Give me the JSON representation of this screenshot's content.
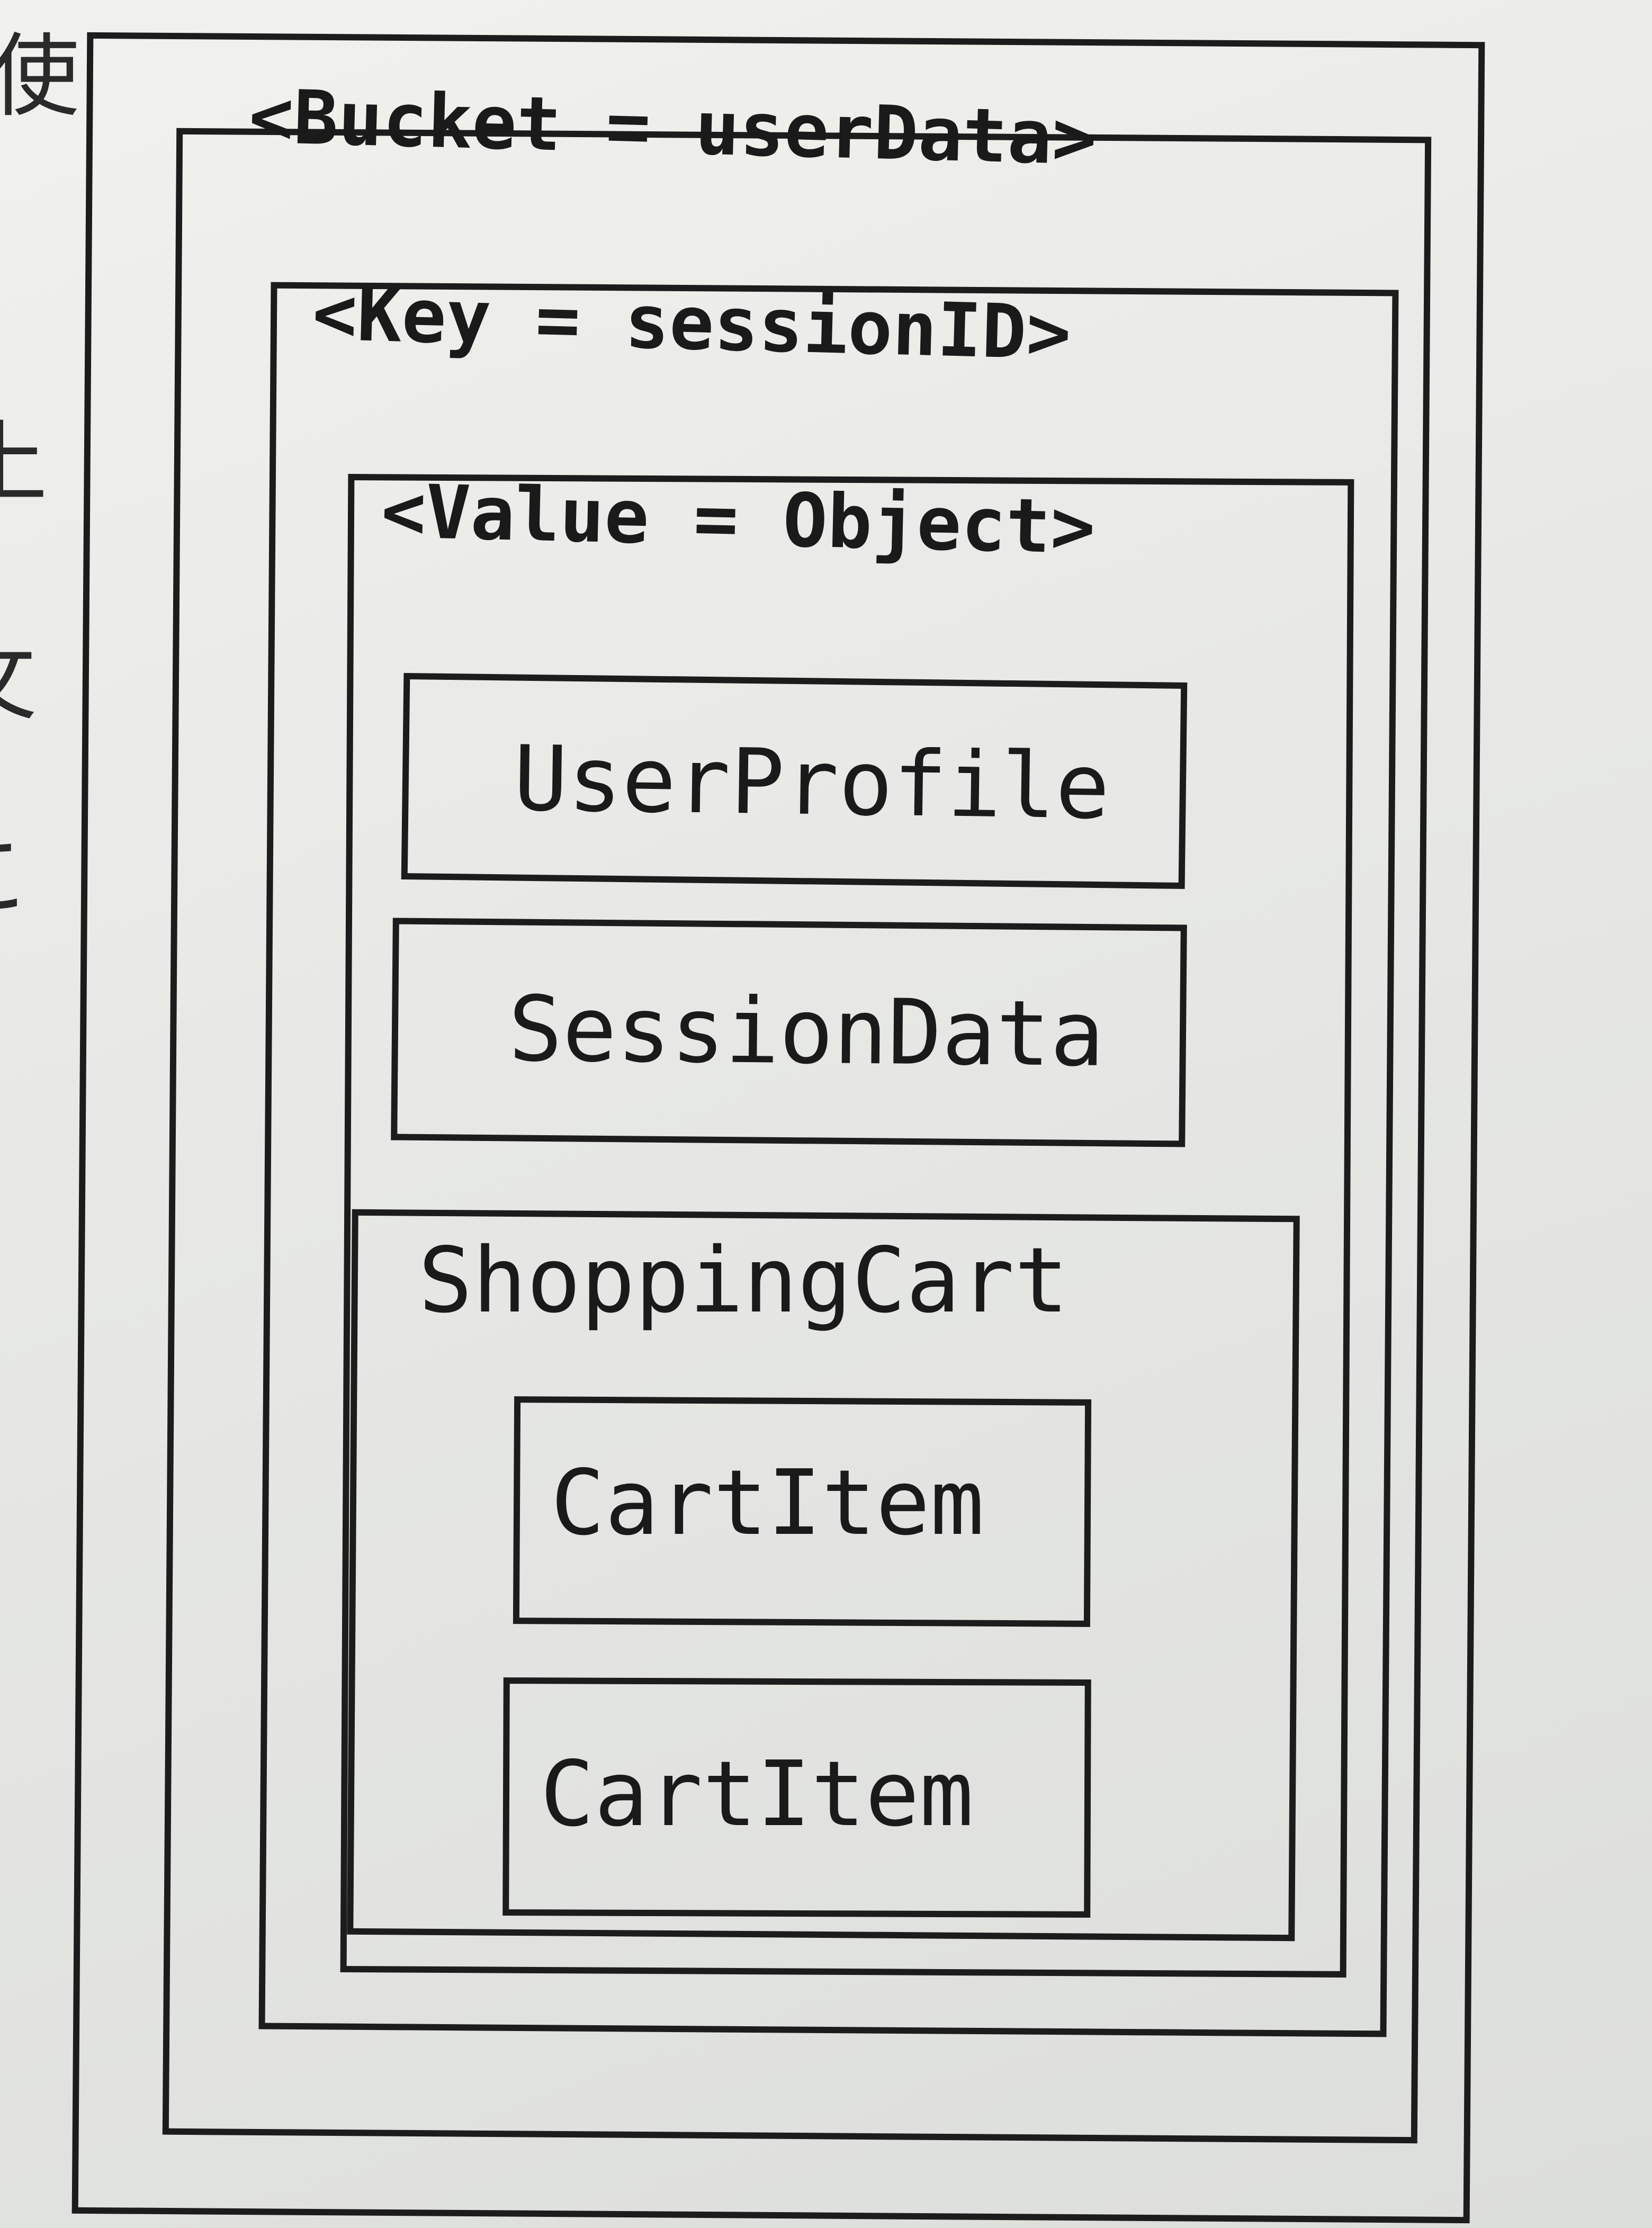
{
  "side_text": [
    "使",
    "上",
    "攵",
    "こ"
  ],
  "diagram": {
    "bucket_label": "<Bucket = userData>",
    "key_label": "<Key = sessionID>",
    "value_label": "<Value = Object>",
    "userprofile_label": "UserProfile",
    "sessiondata_label": "SessionData",
    "shoppingcart_label": "ShoppingCart",
    "cartitem_labels": [
      "CartItem",
      "CartItem"
    ]
  }
}
